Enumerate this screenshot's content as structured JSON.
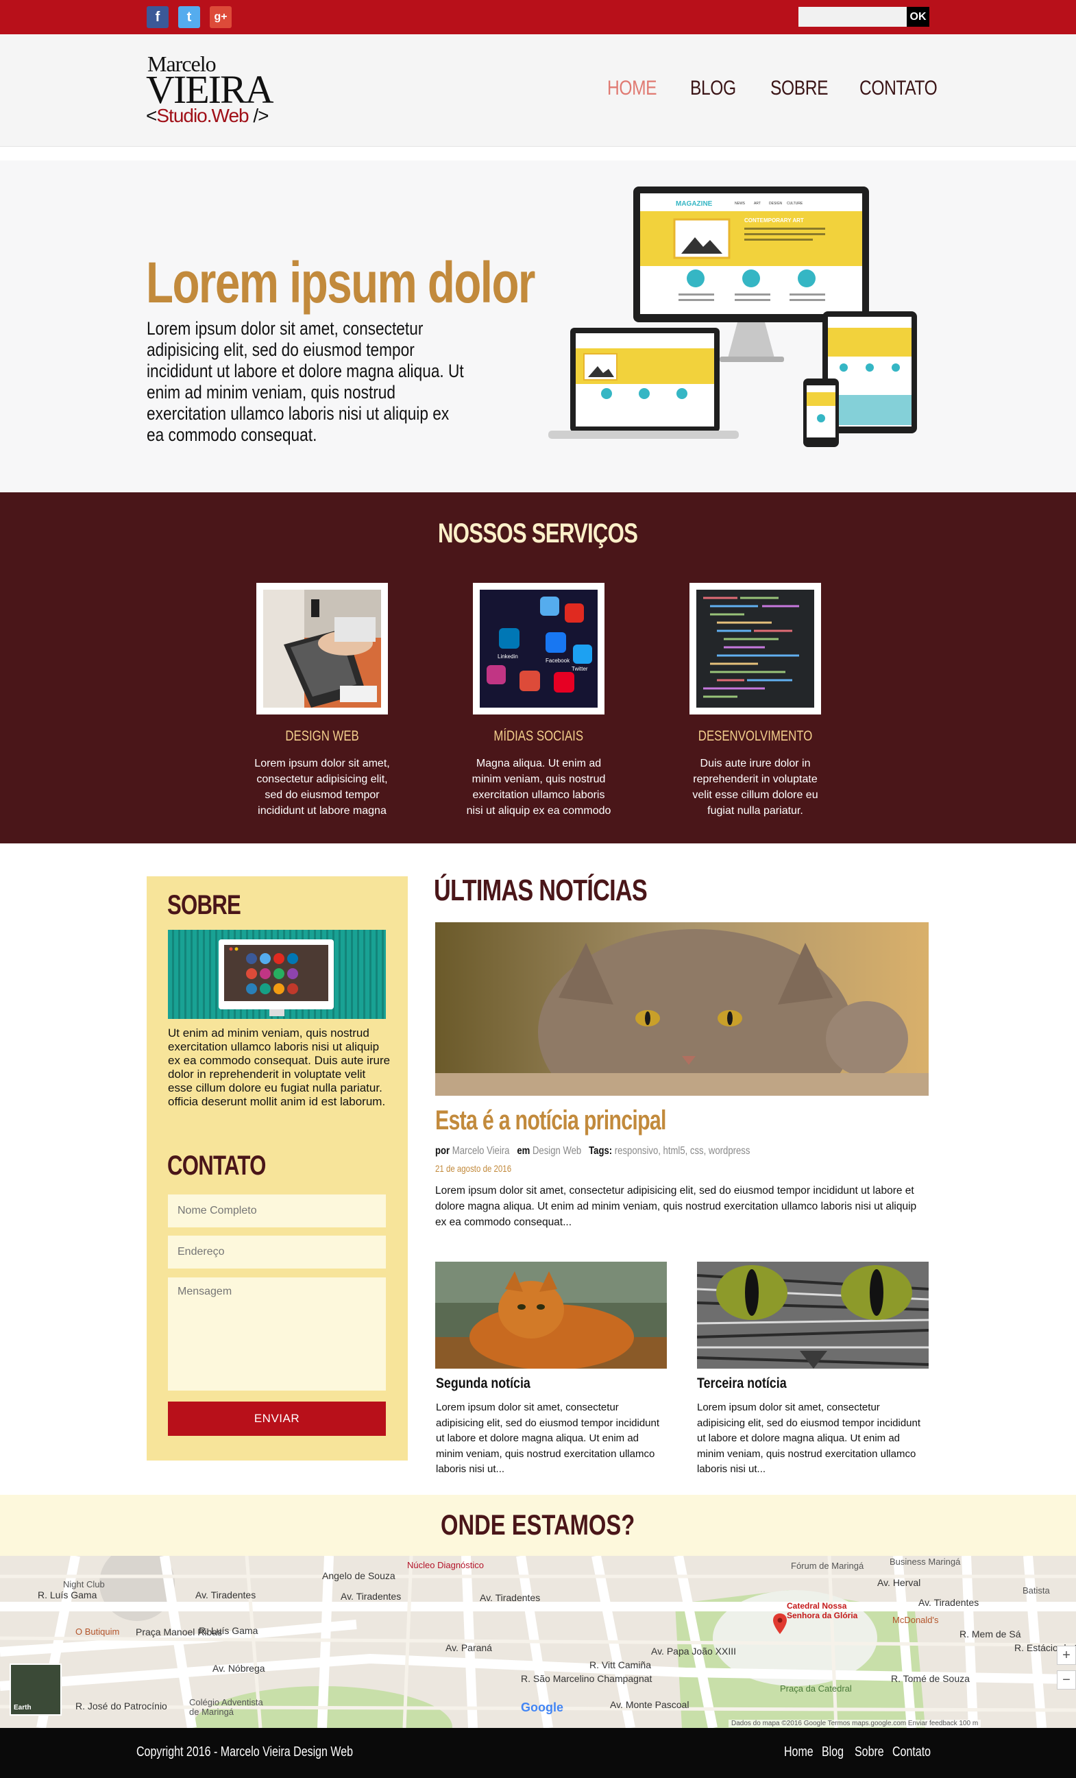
{
  "topbar": {
    "social": [
      {
        "name": "facebook",
        "glyph": "f",
        "color": "#3b5998"
      },
      {
        "name": "twitter",
        "glyph": "t",
        "color": "#55acee"
      },
      {
        "name": "google-plus",
        "glyph": "g+",
        "color": "#dd4b39"
      }
    ],
    "search_button": "OK",
    "accent": "#b8101a"
  },
  "header": {
    "logo": {
      "line1": "Marcelo",
      "line2": "VIEIRA",
      "line3_open": "<",
      "line3": "Studio.Web",
      "line3_close": "/>"
    },
    "nav": [
      "HOME",
      "BLOG",
      "SOBRE",
      "CONTATO"
    ],
    "active_nav": "HOME"
  },
  "hero": {
    "title": "Lorem ipsum dolor",
    "text": "Lorem ipsum dolor sit amet, consectetur adipisicing elit, sed do eiusmod tempor incididunt ut labore et dolore magna aliqua. Ut enim ad minim veniam, quis nostrud exercitation ullamco laboris nisi ut aliquip ex ea commodo consequat.",
    "mockup": {
      "brand": "MAGAZINE",
      "menu": [
        "NEWS",
        "ART",
        "DESIGN",
        "CULTURE"
      ],
      "banner": "CONTEMPORARY ART"
    }
  },
  "services": {
    "title": "NOSSOS SERVIÇOS",
    "items": [
      {
        "name": "DESIGN WEB",
        "desc": "Lorem ipsum dolor sit amet, consectetur adipisicing elit, sed do eiusmod tempor incididunt ut labore magna"
      },
      {
        "name": "MÍDIAS SOCIAIS",
        "desc": "Magna aliqua. Ut enim ad minim veniam, quis nostrud exercitation ullamco laboris nisi ut aliquip ex ea commodo"
      },
      {
        "name": "DESENVOLVIMENTO",
        "desc": "Duis aute irure dolor in reprehenderit in voluptate velit esse cillum dolore eu fugiat nulla pariatur."
      }
    ],
    "social_tiles": [
      "Linkedin",
      "Facebook",
      "Twitter"
    ]
  },
  "sidebar": {
    "about_title": "SOBRE",
    "about_text": "Ut enim ad minim veniam, quis nostrud exercitation ullamco laboris nisi ut aliquip ex ea commodo consequat. Duis aute irure dolor in reprehenderit in voluptate velit esse cillum dolore eu fugiat nulla pariatur. officia deserunt mollit anim id est laborum.",
    "contact_title": "CONTATO",
    "name_placeholder": "Nome Completo",
    "address_placeholder": "Endereço",
    "message_placeholder": "Mensagem",
    "send_label": "ENVIAR"
  },
  "news": {
    "title": "ÚLTIMAS NOTÍCIAS",
    "main": {
      "title": "Esta é a notícia principal",
      "by_label": "por",
      "author": "Marcelo Vieira",
      "in_label": "em",
      "category": "Design Web",
      "tags_label": "Tags:",
      "tags": "responsivo, html5, css, wordpress",
      "date": "21 de agosto de 2016",
      "excerpt": "Lorem ipsum dolor sit amet, consectetur adipisicing elit, sed do eiusmod tempor incididunt ut labore et dolore magna aliqua. Ut enim ad minim veniam, quis nostrud exercitation ullamco laboris nisi ut aliquip ex ea commodo consequat..."
    },
    "second": {
      "title": "Segunda notícia",
      "excerpt": "Lorem ipsum dolor sit amet, consectetur adipisicing elit, sed do eiusmod tempor incididunt ut labore et dolore magna aliqua. Ut enim ad minim veniam, quis nostrud exercitation ullamco laboris nisi ut..."
    },
    "third": {
      "title": "Terceira notícia",
      "excerpt": "Lorem ipsum dolor sit amet, consectetur adipisicing elit, sed do eiusmod tempor incididunt ut labore et dolore magna aliqua. Ut enim ad minim veniam, quis nostrud exercitation ullamco laboris nisi ut..."
    }
  },
  "location": {
    "title": "ONDE ESTAMOS?",
    "map": {
      "streets": [
        "Av. Tiradentes",
        "Av. Tiradentes",
        "Av. Tiradentes",
        "Av. Tiradentes",
        "Av. Nóbrega",
        "Av. Paraná",
        "Av. Papa João XXIII",
        "Praça Manoel Ribas",
        "R. Luís Gama",
        "R. Tomé de Souza",
        "R. Luís Gama",
        "R. José do Patrocínio",
        "Av. Herval",
        "R. Mem de Sá",
        "R. Estácio de Sá",
        "R. São Marcelino Champagnat",
        "R. Vitt Camiña",
        "Av. Monte Pascoal",
        "Angelo de Souza"
      ],
      "places": [
        "Night Club",
        "O Butiquim",
        "Núcleo Diagnóstico",
        "Fórum de Maringá",
        "Business Maringá",
        "Batista",
        "McDonald's",
        "Colégio Adventista de Maringá",
        "Praça da Catedral"
      ],
      "pin_label": "Catedral Nossa Senhora da Glória",
      "earth_label": "Earth",
      "logo": "Google",
      "footer": "Dados do mapa ©2016 Google   Termos   maps.google.com   Enviar feedback   100 m"
    }
  },
  "footer": {
    "copyright": "Copyright 2016 - Marcelo Vieira Design Web",
    "nav": [
      "Home",
      "Blog",
      "Sobre",
      "Contato"
    ]
  }
}
